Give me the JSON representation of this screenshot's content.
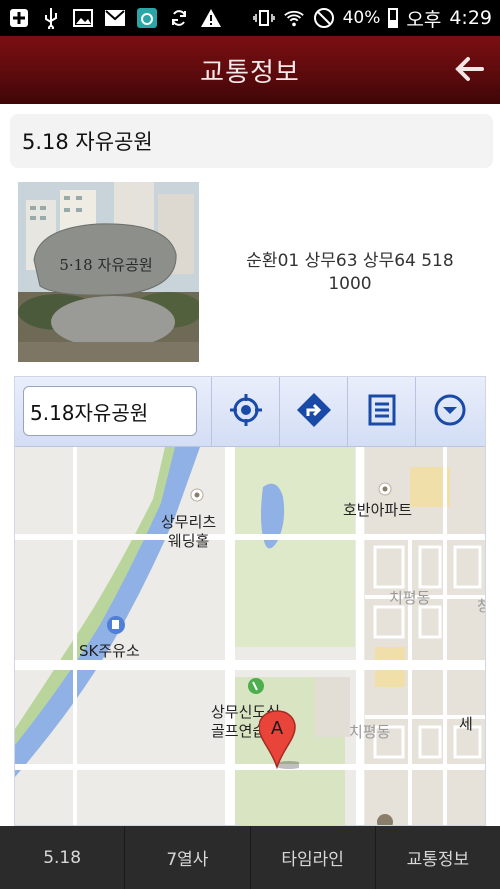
{
  "status_bar": {
    "battery": "40%",
    "ampm": "오후",
    "time": "4:29",
    "icons": [
      "plus-box-icon",
      "usb-icon",
      "image-icon",
      "gmail-icon",
      "camera-app-icon",
      "sync-icon",
      "warning-icon",
      "vibrate-icon",
      "wifi-icon",
      "blocked-icon"
    ]
  },
  "app_bar": {
    "title": "교통정보",
    "back_icon": "back-arrow-icon"
  },
  "place": {
    "name": "5.18 자유공원",
    "photo_caption": "5·18 자유공원",
    "routes_line1": "순환01 상무63  상무64 518",
    "routes_line2": "1000"
  },
  "map": {
    "search_value": "5.18자유공원",
    "toolbar_icons": [
      "target-location-icon",
      "directions-icon",
      "list-icon",
      "dropdown-circle-icon"
    ],
    "marker_letter": "A",
    "labels": {
      "wedding": "상무리츠\n웨딩홀",
      "apartment": "호반아파트",
      "gas": "SK주유소",
      "district1": "치평동",
      "district2": "치평동",
      "golf": "상무신도심\n골프연습장",
      "sejong": "세",
      "edge": "창"
    }
  },
  "bottom_nav": [
    "5.18",
    "7열사",
    "타임라인",
    "교통정보"
  ]
}
